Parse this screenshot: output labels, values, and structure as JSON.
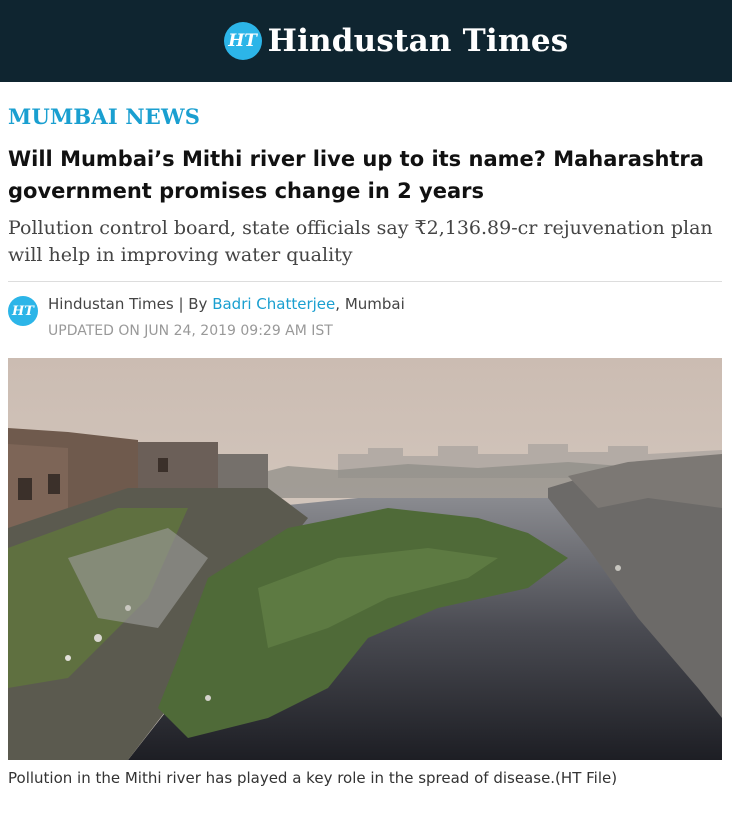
{
  "masthead": {
    "logo_badge": "HT",
    "brand_name": "Hindustan Times",
    "bg_color": "#0f2530",
    "badge_color": "#2cb5e8"
  },
  "article": {
    "section": "MUMBAI NEWS",
    "headline": "Will Mumbai’s Mithi river live up to its name? Maharashtra government promises change in 2 years",
    "summary": "Pollution control board, state officials say ₹2,136.89-cr rejuvenation plan will help in improving water quality",
    "byline": {
      "badge": "HT",
      "publisher": "Hindustan Times",
      "separator": " | By ",
      "author": "Badri Chatterjee",
      "location_sep": ", ",
      "location": "Mumbai",
      "updated": "UPDATED ON JUN 24, 2019 09:29 AM IST"
    },
    "image": {
      "subject": "polluted-river-photo"
    },
    "caption": "Pollution in the Mithi river has played a key role in the spread of disease.(HT File)"
  },
  "colors": {
    "accent": "#1a9fd0"
  }
}
